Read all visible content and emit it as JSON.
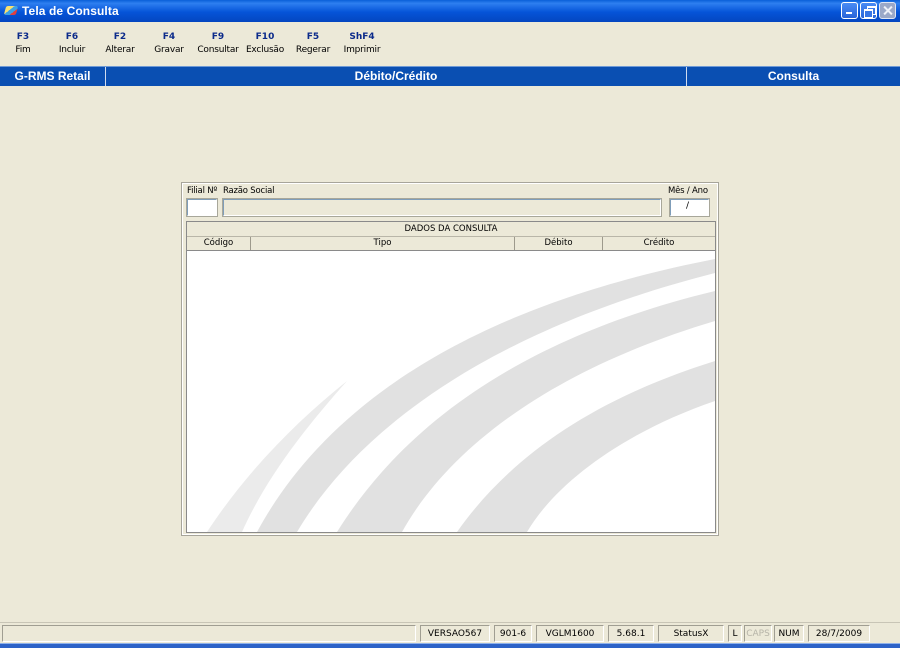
{
  "window": {
    "title": "Tela de Consulta"
  },
  "function_keys": [
    {
      "key": "F3",
      "label": "Fim"
    },
    {
      "key": "F6",
      "label": "Incluir"
    },
    {
      "key": "F2",
      "label": "Alterar"
    },
    {
      "key": "F4",
      "label": "Gravar"
    },
    {
      "key": "F9",
      "label": "Consultar"
    },
    {
      "key": "F10",
      "label": "Exclusão"
    },
    {
      "key": "F5",
      "label": "Regerar"
    },
    {
      "key": "ShF4",
      "label": "Imprimir"
    }
  ],
  "header": {
    "app": "G-RMS Retail",
    "module": "Débito/Crédito",
    "mode": "Consulta"
  },
  "form": {
    "filial_label": "Filial Nº",
    "razao_label": "Razão Social",
    "mes_ano_label": "Mês / Ano",
    "filial_value": "",
    "razao_value": "",
    "mes_ano_value": "/"
  },
  "grid": {
    "caption": "DADOS DA CONSULTA",
    "columns": [
      "Código",
      "Tipo",
      "Débito",
      "Crédito"
    ]
  },
  "status_bar": {
    "version": "VERSAO567",
    "code": "901-6",
    "program": "VGLM1600",
    "build": "5.68.1",
    "status": "StatusX",
    "mode_l": "L",
    "caps": "CAPS",
    "num": "NUM",
    "date": "28/7/2009"
  }
}
